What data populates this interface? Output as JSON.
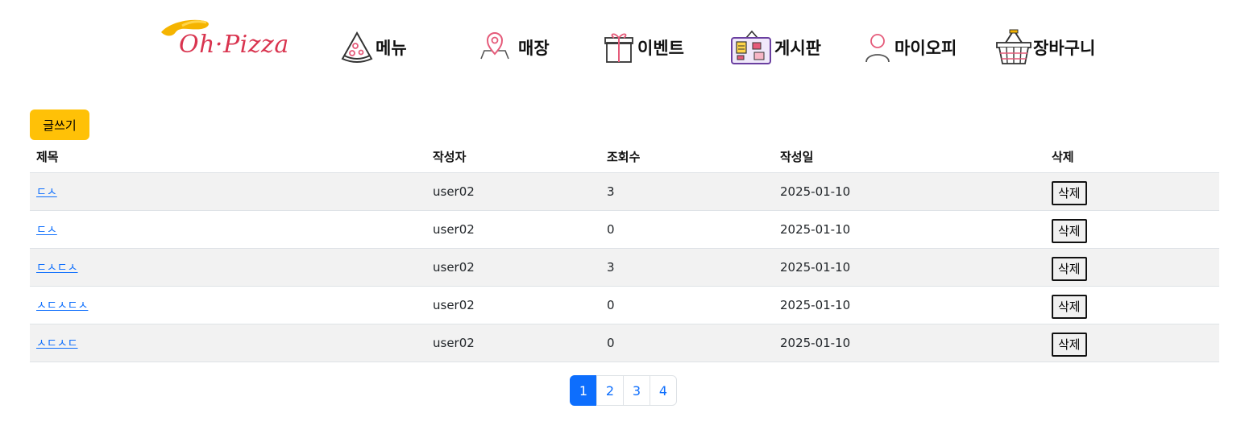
{
  "header": {
    "logo_text": "Oh·Pizza",
    "nav": [
      {
        "label": "메뉴",
        "icon": "pizza-slice-icon"
      },
      {
        "label": "매장",
        "icon": "map-pin-icon"
      },
      {
        "label": "이벤트",
        "icon": "gift-icon"
      },
      {
        "label": "게시판",
        "icon": "bulletin-board-icon"
      },
      {
        "label": "마이오피",
        "icon": "user-icon"
      },
      {
        "label": "장바구니",
        "icon": "basket-icon"
      }
    ]
  },
  "toolbar": {
    "write_label": "글쓰기"
  },
  "table": {
    "headers": [
      "제목",
      "작성자",
      "조회수",
      "작성일",
      "삭제"
    ],
    "rows": [
      {
        "title": "ㄷㅅ",
        "author": "user02",
        "views": "3",
        "date": "2025-01-10",
        "delete_label": "삭제"
      },
      {
        "title": "ㄷㅅ",
        "author": "user02",
        "views": "0",
        "date": "2025-01-10",
        "delete_label": "삭제"
      },
      {
        "title": "ㄷㅅㄷㅅ",
        "author": "user02",
        "views": "3",
        "date": "2025-01-10",
        "delete_label": "삭제"
      },
      {
        "title": "ㅅㄷㅅㄷㅅ",
        "author": "user02",
        "views": "0",
        "date": "2025-01-10",
        "delete_label": "삭제"
      },
      {
        "title": "ㅅㄷㅅㄷ",
        "author": "user02",
        "views": "0",
        "date": "2025-01-10",
        "delete_label": "삭제"
      }
    ]
  },
  "pagination": {
    "pages": [
      "1",
      "2",
      "3",
      "4"
    ],
    "current": "1"
  },
  "colors": {
    "accent": "#ffc107",
    "brand": "#d9344f",
    "link": "#0d6efd",
    "row_stripe": "#f2f2f2"
  }
}
